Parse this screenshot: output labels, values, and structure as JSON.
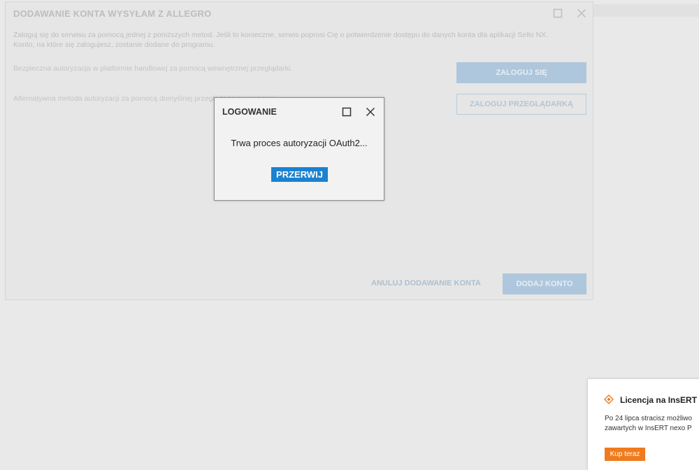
{
  "main_dialog": {
    "title": "DODAWANIE KONTA WYSYŁAM Z ALLEGRO",
    "description_line1": "Zaloguj się do serwisu za pomocą jednej z poniższych metod. Jeśli to konieczne, serwis poprosi Cię o potwierdzenie dostępu do danych konta dla aplikacji Sello NX.",
    "description_line2": "Konto, na które się zalogujesz, zostanie dodane do programu.",
    "option_internal_text": "Bezpieczna autoryzacja w platformie handlowej za pomocą wewnętrznej przeglądarki.",
    "option_internal_button": "ZALOGUJ SIĘ",
    "option_external_text": "Alternatywna metoda autoryzacji za pomocą domyślnej przeglądarki zewnętrznej.",
    "option_external_button": "ZALOGUJ PRZEGLĄDARKĄ",
    "cancel_label": "ANULUJ DODAWANIE KONTA",
    "add_label": "DODAJ KONTO"
  },
  "login_dialog": {
    "title": "LOGOWANIE",
    "message": "Trwa proces autoryzacji OAuth2...",
    "abort_label": "PRZERWIJ"
  },
  "license_notice": {
    "title": "Licencja na InsERT",
    "body_line1": "Po 24 lipca stracisz możliwo",
    "body_line2": "zawartych w InsERT nexo P",
    "buy_label": "Kup teraz"
  },
  "colors": {
    "accent": "#1a82d0",
    "orange": "#ef7b1e"
  },
  "icons": {
    "maximize": "maximize-icon",
    "close": "close-icon",
    "license": "diamond-warning-icon"
  }
}
